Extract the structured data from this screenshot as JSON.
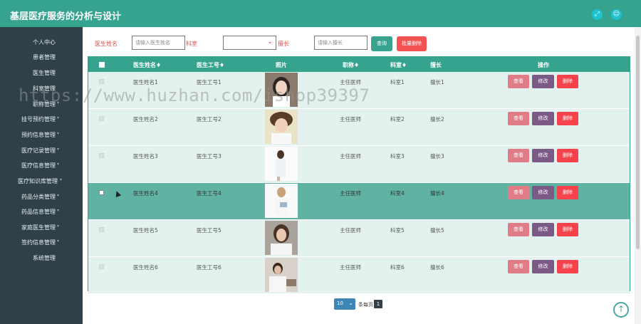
{
  "app": {
    "title": "基层医疗服务的分析与设计"
  },
  "header_icons": [
    {
      "name": "fullscreen",
      "glyph": "⤢"
    },
    {
      "name": "user",
      "glyph": "☺"
    }
  ],
  "sidebar": {
    "items": [
      {
        "label": "个人中心"
      },
      {
        "label": "患者管理"
      },
      {
        "label": "医生管理"
      },
      {
        "label": "科室管理"
      },
      {
        "label": "职称管理"
      },
      {
        "label": "挂号预约管理"
      },
      {
        "label": "预约信息管理"
      },
      {
        "label": "医疗记录管理"
      },
      {
        "label": "医疗信息管理"
      },
      {
        "label": "医疗知识库管理"
      },
      {
        "label": "药品分类管理"
      },
      {
        "label": "药品信息管理"
      },
      {
        "label": "家庭医生管理"
      },
      {
        "label": "签约信息管理"
      },
      {
        "label": "系统管理"
      }
    ]
  },
  "search": {
    "doctor_name_label": "医生姓名",
    "doctor_name_placeholder": "请输入医生姓名",
    "department_label": "科室",
    "department_value": "",
    "director_label": "擅长",
    "director_placeholder": "请输入擅长",
    "query_button": "查询",
    "batch_delete_button": "批量删除"
  },
  "table": {
    "headers": [
      "医生姓名♦",
      "医生工号♦",
      "照片",
      "职称♦",
      "科室♦",
      "擅长",
      "操作"
    ],
    "rows": [
      {
        "name": "医生姓名1",
        "id": "医生工号1",
        "title": "主任医师",
        "dept": "科室1",
        "skill": "擅长1"
      },
      {
        "name": "医生姓名2",
        "id": "医生工号2",
        "title": "主任医师",
        "dept": "科室2",
        "skill": "擅长2"
      },
      {
        "name": "医生姓名3",
        "id": "医生工号3",
        "title": "主任医师",
        "dept": "科室3",
        "skill": "擅长3"
      },
      {
        "name": "医生姓名4",
        "id": "医生工号4",
        "title": "主任医师",
        "dept": "科室4",
        "skill": "擅长4"
      },
      {
        "name": "医生姓名5",
        "id": "医生工号5",
        "title": "主任医师",
        "dept": "科室5",
        "skill": "擅长5"
      },
      {
        "name": "医生姓名6",
        "id": "医生工号6",
        "title": "主任医师",
        "dept": "科室6",
        "skill": "擅长6"
      }
    ],
    "highlighted_row": 4,
    "actions": {
      "view": "查看",
      "edit": "修改",
      "delete": "删除"
    }
  },
  "pagination": {
    "page_size": "10",
    "total_text": "条每页",
    "current_page": "1"
  },
  "watermark": "https://www.huzhan.com/ishop39397",
  "colors": {
    "primary": "#35a38e",
    "sidebar": "#304049",
    "danger": "#f25252"
  }
}
